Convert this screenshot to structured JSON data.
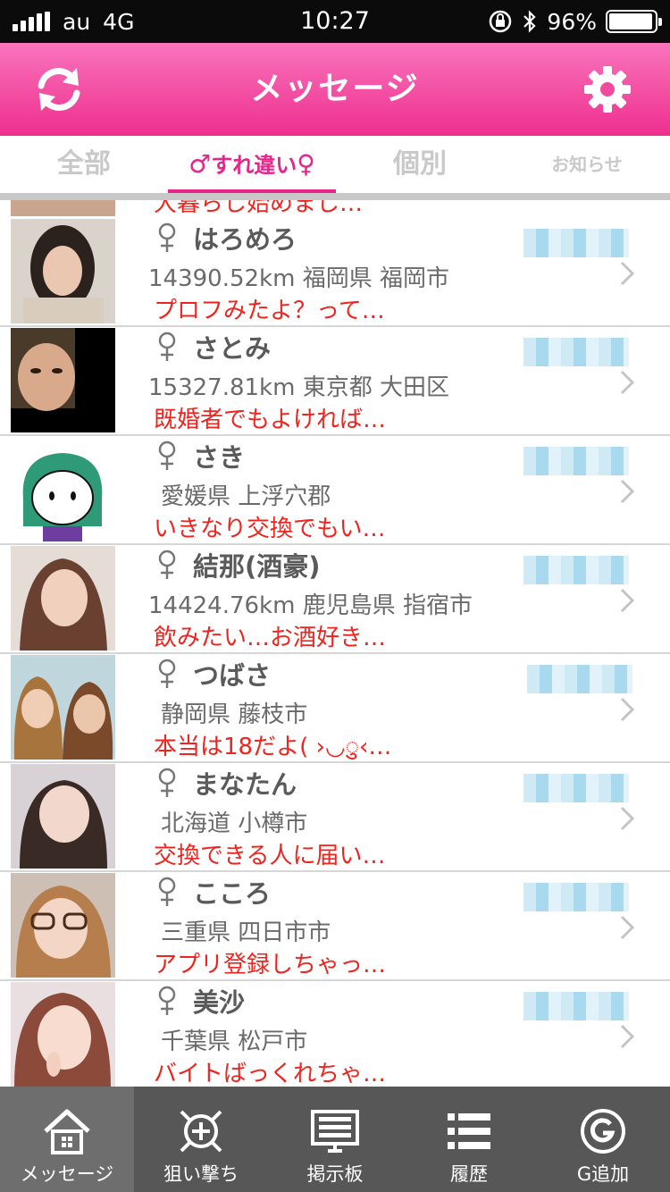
{
  "status": {
    "carrier": "au",
    "network": "4G",
    "time": "10:27",
    "battery": "96%",
    "battery_level": 0.96
  },
  "header": {
    "title": "メッセージ"
  },
  "tabs": {
    "all": "全部",
    "pass": "すれ違い",
    "individual": "個別",
    "notice": "お知らせ"
  },
  "partial_row": {
    "message": "大暮らし始めまし…"
  },
  "users": [
    {
      "name": "はろめろ",
      "location": "14390.52km 福岡県 福岡市",
      "message": "プロフみたよ？って…"
    },
    {
      "name": "さとみ",
      "location": "15327.81km 東京都 大田区",
      "message": "既婚者でもよければ…"
    },
    {
      "name": "さき",
      "location": "愛媛県 上浮穴郡",
      "message": "いきなり交換でもい…"
    },
    {
      "name": "結那(酒豪)",
      "location": "14424.76km 鹿児島県 指宿市",
      "message": "飲みたい…お酒好き…"
    },
    {
      "name": "つばさ",
      "location": "静岡県 藤枝市",
      "message": "本当は18だよ( ›◡ु‹…"
    },
    {
      "name": "まなたん",
      "location": "北海道 小樽市",
      "message": "交換できる人に届い…"
    },
    {
      "name": "こころ",
      "location": "三重県 四日市市",
      "message": "アプリ登録しちゃっ…"
    },
    {
      "name": "美沙",
      "location": "千葉県 松戸市",
      "message": "バイトばっくれちゃ…"
    }
  ],
  "nav": {
    "message": "メッセージ",
    "target": "狙い撃ち",
    "board": "掲示板",
    "history": "履歴",
    "g_add": "G追加"
  },
  "colors": {
    "accent": "#e8238a",
    "message_text": "#f0231e",
    "nav_bg": "#575757"
  }
}
